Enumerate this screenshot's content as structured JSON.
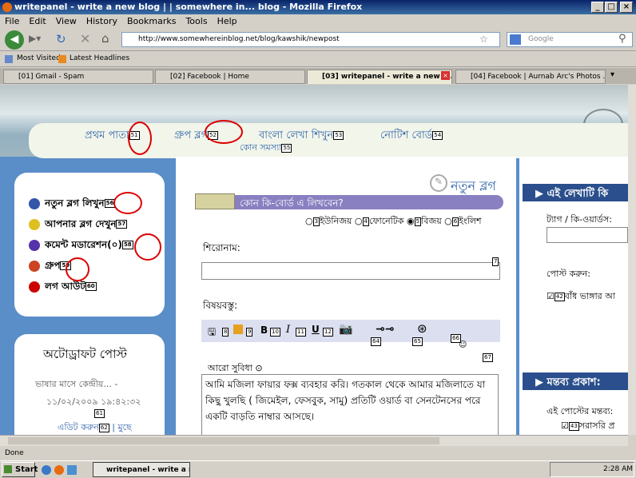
{
  "window": {
    "title": "writepanel - write a new blog | | somewhere in... blog - Mozilla Firefox",
    "min": "_",
    "max": "□",
    "close": "×"
  },
  "menu": [
    "File",
    "Edit",
    "View",
    "History",
    "Bookmarks",
    "Tools",
    "Help"
  ],
  "address": {
    "url": "http://www.somewhereinblog.net/blog/kawshik/newpost",
    "search_placeholder": "Google"
  },
  "bookmarks": [
    "Most Visited",
    "Latest Headlines"
  ],
  "tabs": [
    {
      "label": "[01] Gmail - Spam"
    },
    {
      "label": "[02] Facebook | Home"
    },
    {
      "label": "[03] writepanel - write a new bl..."
    },
    {
      "label": "[04] Facebook | Aurnab Arc's Photos ..."
    }
  ],
  "site_nav": [
    {
      "label": "প্রথম পাতা",
      "num": "51"
    },
    {
      "label": "গ্রুপ ব্লগ",
      "num": "52"
    },
    {
      "label": "বাংলা লেখা শিখুন",
      "num": "53"
    },
    {
      "label": "নোটিশ বোর্ড",
      "num": "54"
    },
    {
      "label": "কোন সমস্যা",
      "num": "55"
    }
  ],
  "left_menu": [
    {
      "label": "নতুন ব্লগ লিখুন",
      "num": "56",
      "color": "#3355aa"
    },
    {
      "label": "আপনার ব্লগ দেখুন",
      "num": "57",
      "color": "#e0c020"
    },
    {
      "label": "কমেন্ট মডারেশন(০)",
      "num": "58",
      "color": "#5533aa"
    },
    {
      "label": "গ্রুপ",
      "num": "59",
      "color": "#cc4422"
    },
    {
      "label": "লগ আউট",
      "num": "60",
      "color": "#cc0000"
    }
  ],
  "autodraft": {
    "title": "অটোড্রাফট পোস্ট",
    "entry": "ভাষার মাসে কেন্দ্রীয়... -",
    "date": "১১/০২/২০০৯ ১৯:৪২:৩২",
    "num": "61",
    "edit": "এডিট করুন",
    "edit_num": "62",
    "delete": "মুছে"
  },
  "editor": {
    "heading": "নতুন ব্লগ",
    "kbd_prompt": "কোন কি-বোর্ড এ লিখবেন?",
    "kbd_options": [
      {
        "num": "3",
        "label": "ইউনিজয়"
      },
      {
        "num": "4",
        "label": "ফোনেটিক"
      },
      {
        "num": "5",
        "label": "বিজয়"
      },
      {
        "num": "6",
        "label": "ইংলিশ"
      }
    ],
    "title_label": "শিরোনাম:",
    "title_num": "7",
    "body_label": "বিষয়বস্তু:",
    "toolbar_nums": [
      "8",
      "9",
      "10",
      "11",
      "12",
      "64",
      "65",
      "66",
      "67"
    ],
    "more": "আরো সুবিধা",
    "body_text": "আমি মজিলা ফায়ার ফক্স ব্যবহার করি। গতকাল থেকে আমার মজিলাতে যা কিছু খুলছি ( জিমেইল, ফেসবুক, সামু) প্রতিটি ওয়ার্ড বা সেনটেনসের পরে একটি বাড়তি নাম্বার আসছে।"
  },
  "right": {
    "section1": "এই লেখাটি কি",
    "tag_label": "ট্যাগ / কি-ওয়ার্ডস:",
    "post_label": "পোস্ট করুন:",
    "checkbox_num": "42",
    "checkbox_label": "বাঁধ ভাঙ্গার আ",
    "section2": "মন্তব্য প্রকাশ:",
    "comment_label": "এই পোস্টের মন্তব্য:",
    "direct_num": "43",
    "direct_label": "সরাসরি প্র"
  },
  "status": "Done",
  "taskbar": {
    "start": "Start",
    "task": "writepanel - write a n...",
    "time": "2:28 AM"
  }
}
